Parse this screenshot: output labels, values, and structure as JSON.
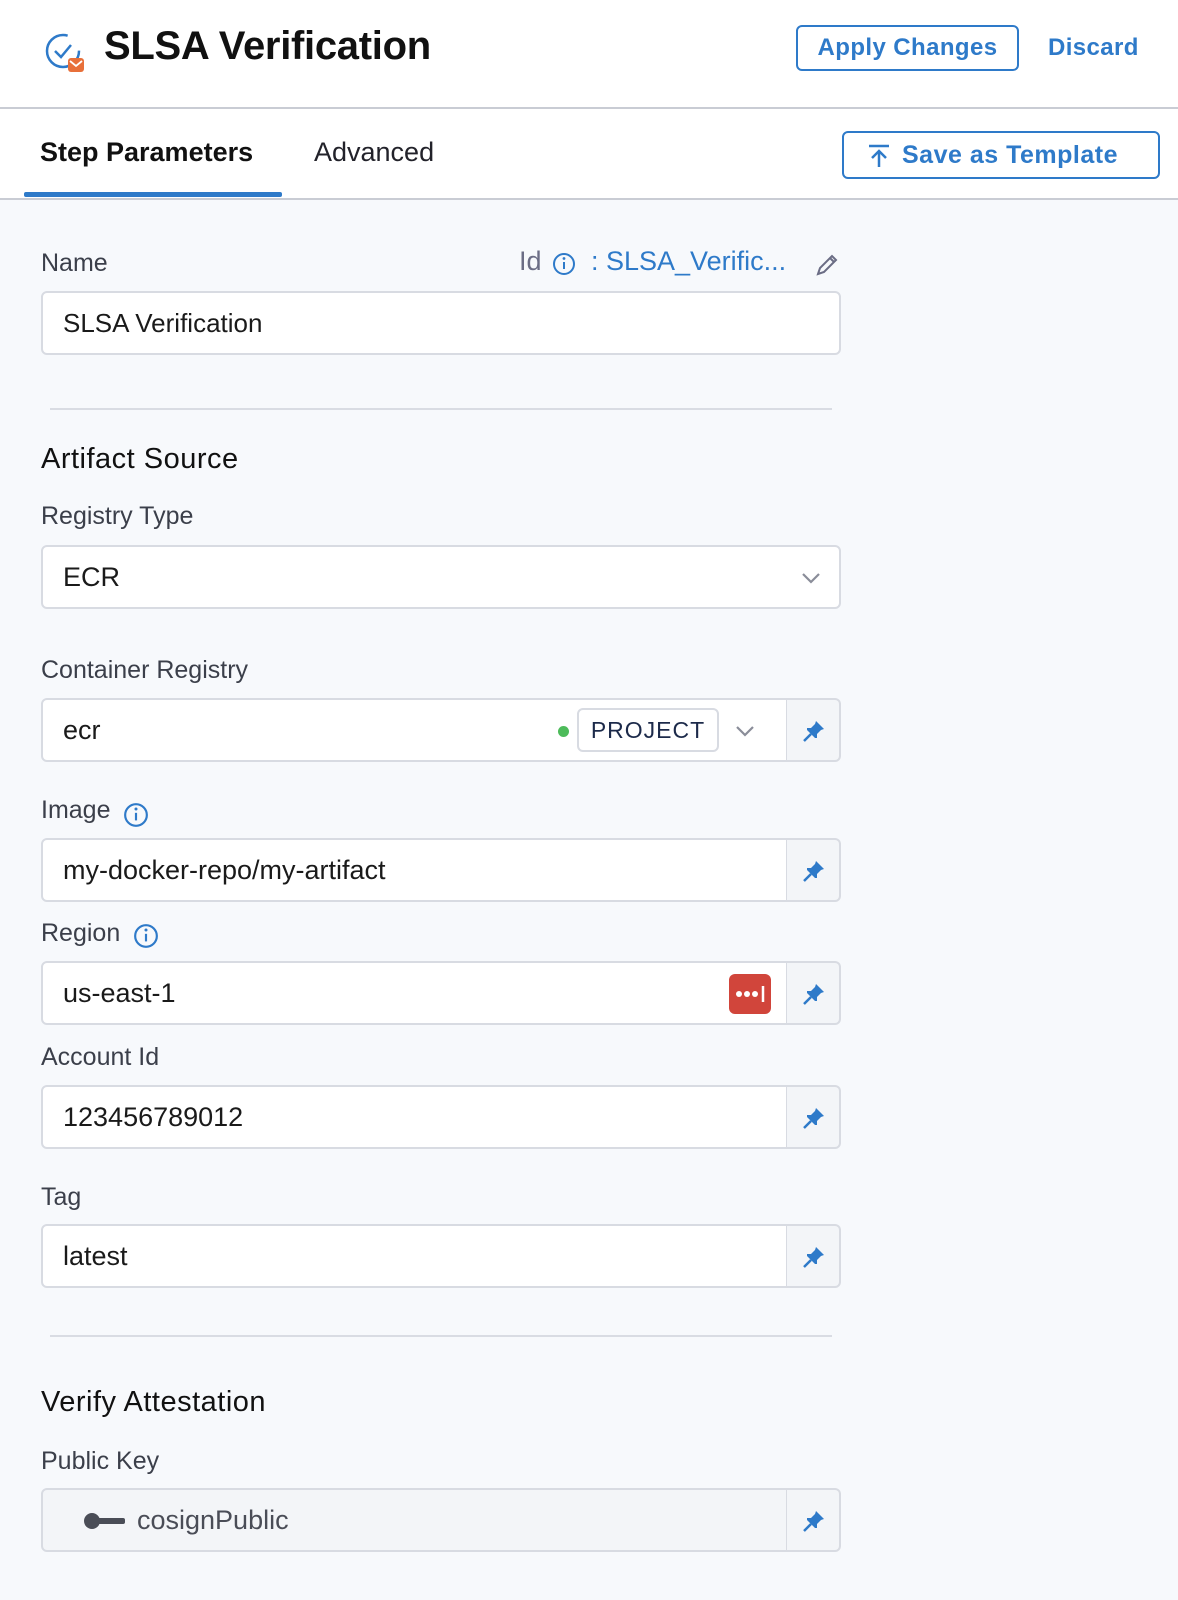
{
  "header": {
    "title": "SLSA Verification",
    "apply_label": "Apply Changes",
    "discard_label": "Discard"
  },
  "tabs": [
    {
      "label": "Step Parameters",
      "active": true
    },
    {
      "label": "Advanced",
      "active": false
    }
  ],
  "save_template_label": "Save as Template",
  "name_field": {
    "label": "Name",
    "value": "SLSA Verification",
    "id_label": "Id",
    "id_value": ": SLSA_Verific..."
  },
  "artifact_source": {
    "title": "Artifact Source",
    "registry_type": {
      "label": "Registry Type",
      "value": "ECR"
    },
    "container_registry": {
      "label": "Container Registry",
      "value": "ecr",
      "scope": "PROJECT"
    },
    "image": {
      "label": "Image",
      "value": "my-docker-repo/my-artifact"
    },
    "region": {
      "label": "Region",
      "value": "us-east-1"
    },
    "account_id": {
      "label": "Account Id",
      "value": "123456789012"
    },
    "tag": {
      "label": "Tag",
      "value": "latest"
    }
  },
  "verify_attestation": {
    "title": "Verify Attestation",
    "public_key": {
      "label": "Public Key",
      "value": "cosignPublic"
    }
  },
  "colors": {
    "accent": "#2e7ac9",
    "status_dot": "#4dbb5a",
    "secret_badge": "#d1453b"
  }
}
